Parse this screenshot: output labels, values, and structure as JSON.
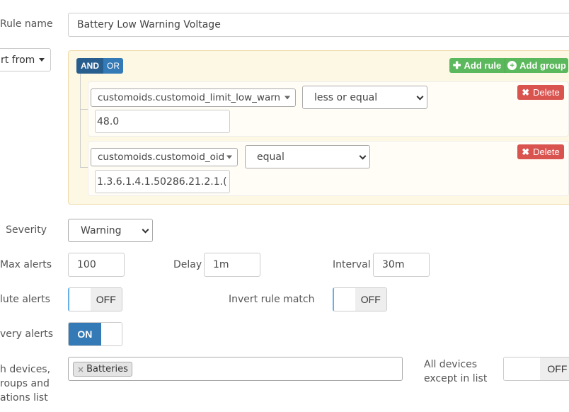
{
  "rule_name": {
    "label": "Rule name",
    "value": "Battery Low Warning Voltage"
  },
  "import_from": {
    "label": "rt from"
  },
  "builder": {
    "and_label": "AND",
    "or_label": "OR",
    "add_rule_label": "Add rule",
    "add_group_label": "Add group",
    "rules": [
      {
        "field": "customoids.customoid_limit_low_warn",
        "operator": "less or equal",
        "value": "48.0",
        "delete_label": "Delete"
      },
      {
        "field": "customoids.customoid_oid",
        "operator": "equal",
        "value": "1.3.6.1.4.1.50286.21.2.1.(",
        "delete_label": "Delete"
      }
    ]
  },
  "severity": {
    "label": "Severity",
    "value": "Warning"
  },
  "max_alerts": {
    "label": "Max alerts",
    "value": "100"
  },
  "delay": {
    "label": "Delay",
    "value": "1m"
  },
  "interval": {
    "label": "Interval",
    "value": "30m"
  },
  "mute_alerts": {
    "label": "lute alerts",
    "state": "OFF"
  },
  "invert_rule_match": {
    "label": "Invert rule match",
    "state": "OFF"
  },
  "recovery_alerts": {
    "label": "very alerts",
    "state": "ON"
  },
  "devices": {
    "label_lines": [
      "h devices,",
      "roups and",
      "ations list"
    ],
    "tags": [
      "Batteries"
    ],
    "tag_remove": "×"
  },
  "all_devices_except": {
    "label_lines": [
      "All devices",
      "except in list"
    ],
    "state": "OFF"
  },
  "colors": {
    "primary": "#337ab7",
    "primary_dark": "#285e8e",
    "success": "#5cb85c",
    "danger": "#d9534f",
    "builder_bg": "#fcf8e3",
    "builder_border": "#f5deb3"
  }
}
